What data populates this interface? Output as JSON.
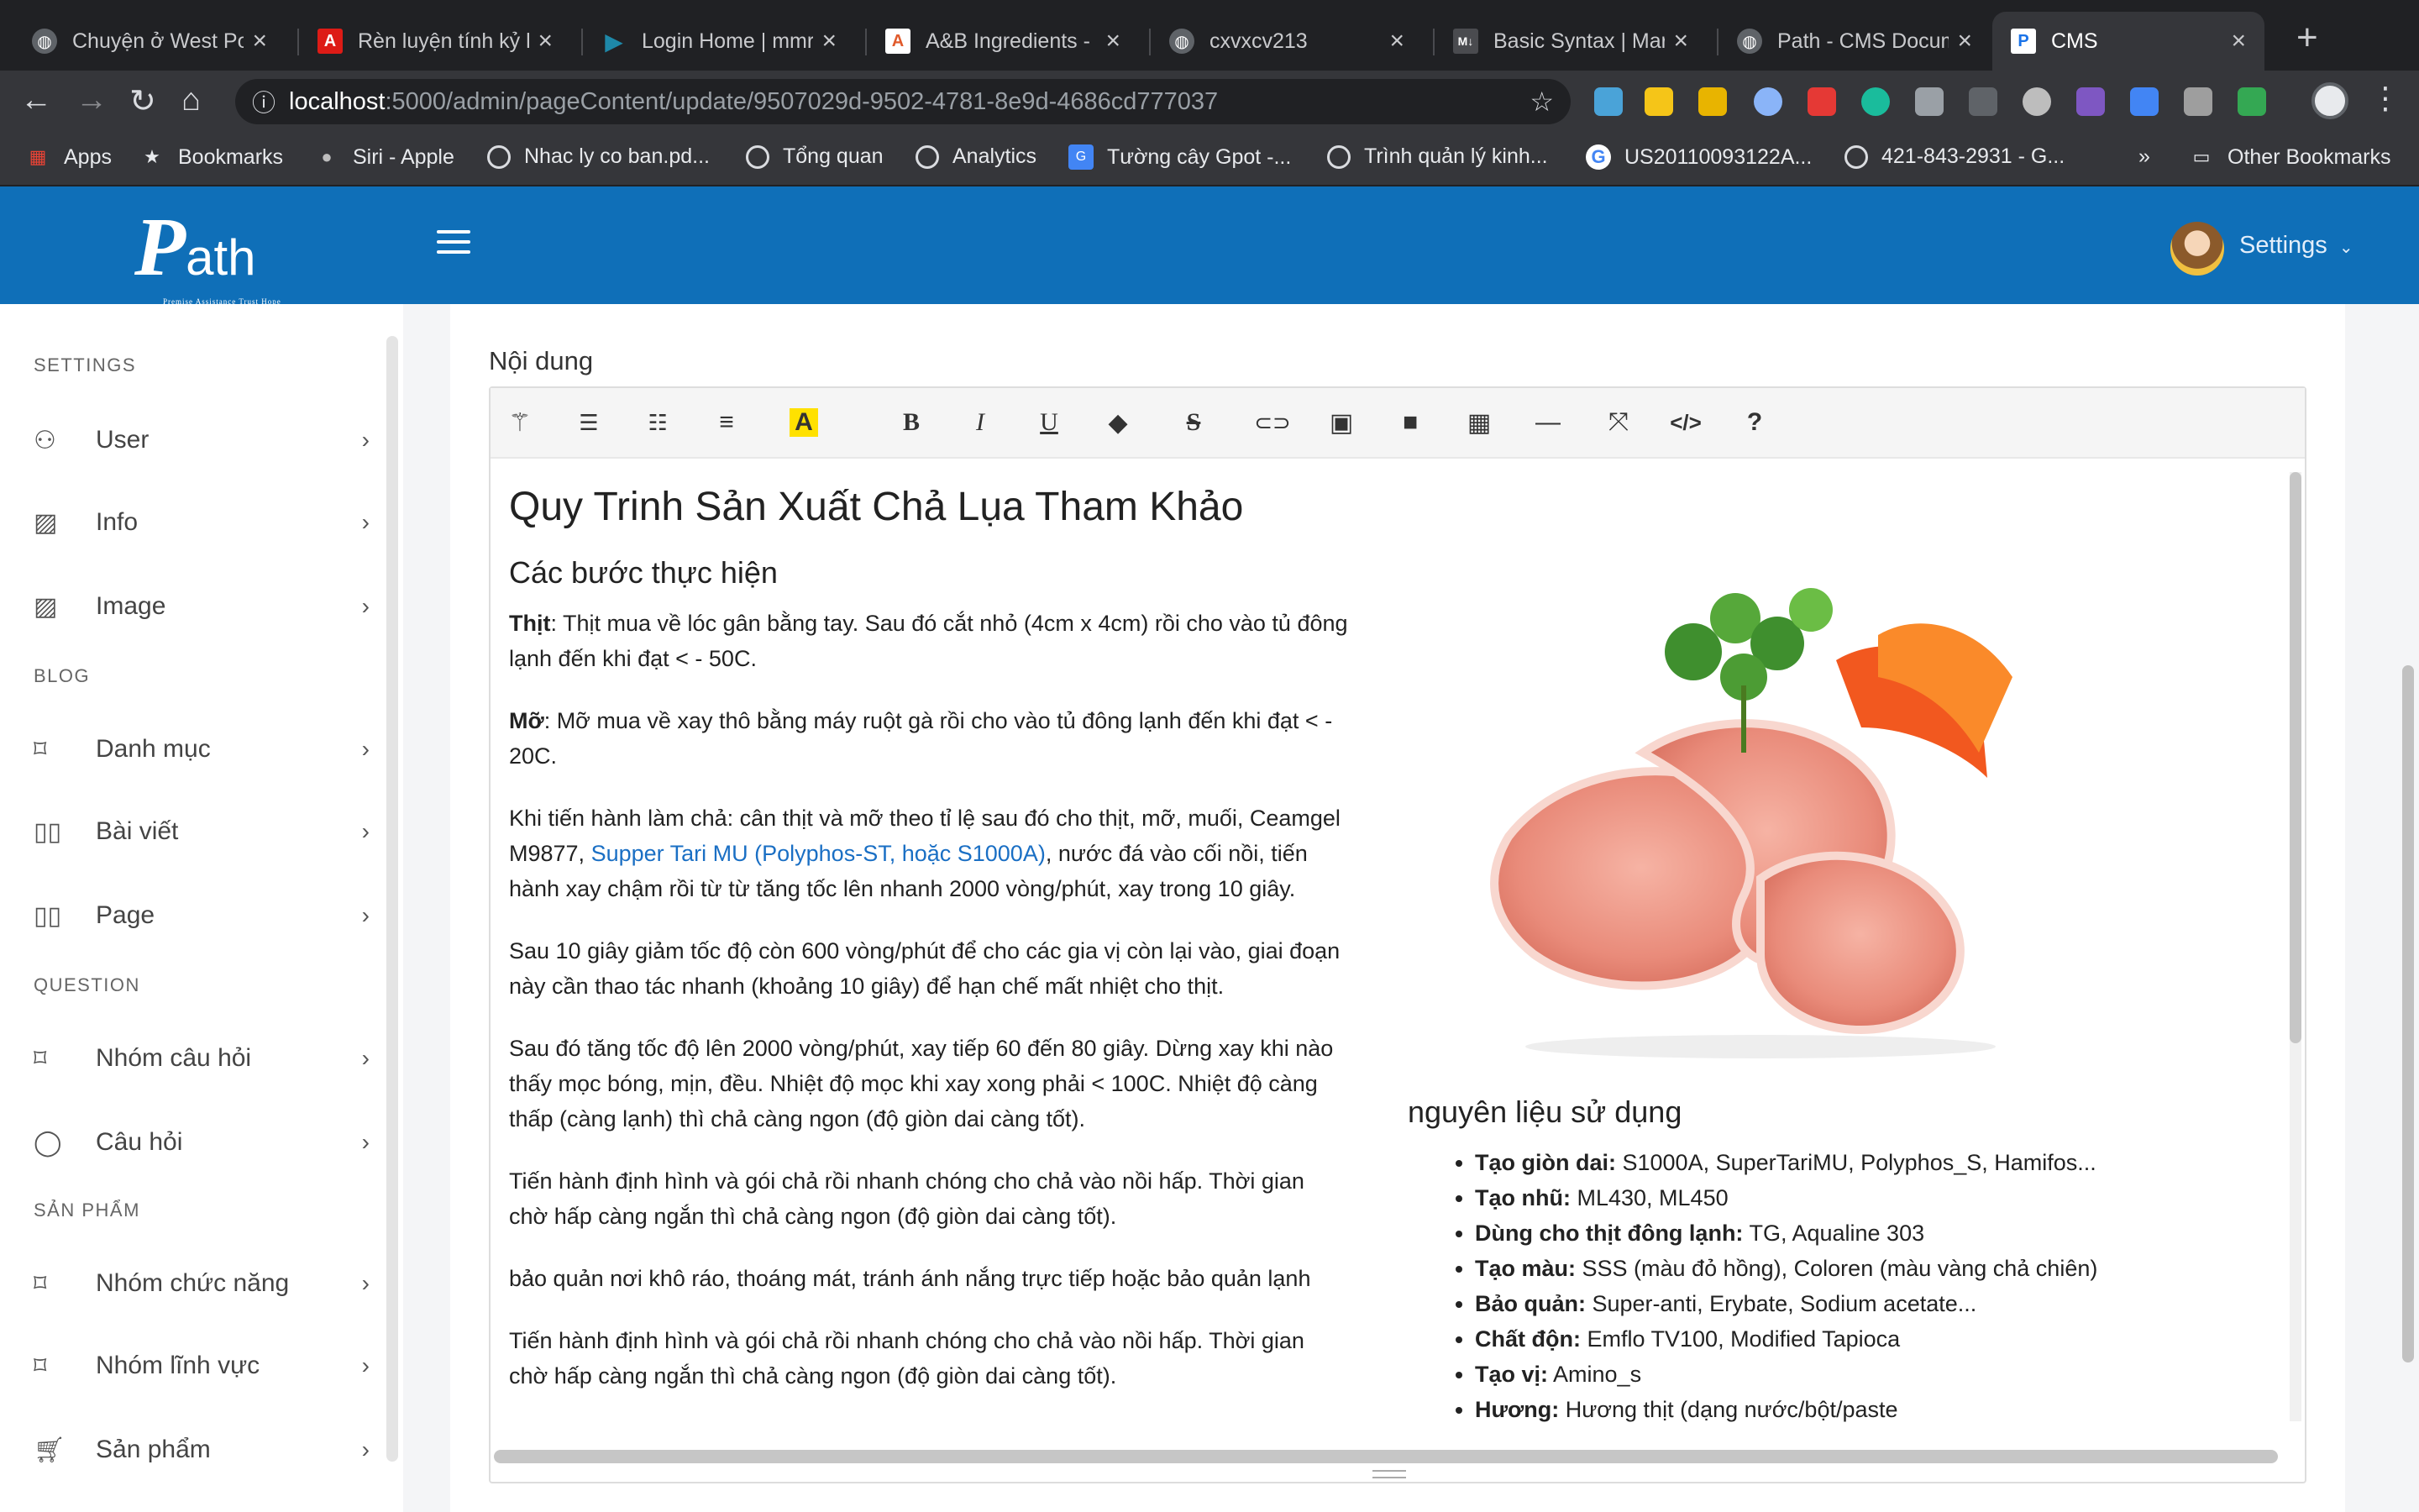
{
  "browser": {
    "tabs": [
      {
        "title": "Chuyện ở West Po",
        "icon": "globe-icon",
        "color": "#5f6368"
      },
      {
        "title": "Rèn luyện tính kỷ l",
        "icon": "angular-icon",
        "color": "#dd1b16"
      },
      {
        "title": "Login Home | mmr",
        "icon": "play-icon",
        "color": "#1e88a8"
      },
      {
        "title": "A&B Ingredients -",
        "icon": "ab-logo-icon",
        "color": "#e05a2b"
      },
      {
        "title": "cxvxcv213",
        "icon": "globe-icon",
        "color": "#5f6368"
      },
      {
        "title": "Basic Syntax | Mar",
        "icon": "markdown-icon",
        "color": "#4a4b4f"
      },
      {
        "title": "Path - CMS Docum",
        "icon": "globe-icon",
        "color": "#5f6368"
      },
      {
        "title": "CMS",
        "icon": "cms-icon",
        "color": "#1a73e8"
      }
    ],
    "url_host": "localhost",
    "url_path": ":5000/admin/pageContent/update/9507029d-9502-4781-8e9d-4686cd777037",
    "bookmarks": [
      {
        "label": "Apps",
        "icon": "apps-grid-icon"
      },
      {
        "label": "Bookmarks",
        "icon": "star-icon"
      },
      {
        "label": "Siri - Apple",
        "icon": "apple-icon"
      },
      {
        "label": "Nhac ly co ban.pd...",
        "icon": "globe-icon"
      },
      {
        "label": "Tổng quan",
        "icon": "globe-icon"
      },
      {
        "label": "Analytics",
        "icon": "globe-icon"
      },
      {
        "label": "Tường cây Gpot -...",
        "icon": "gpot-icon"
      },
      {
        "label": "Trình quản lý kinh...",
        "icon": "globe-icon"
      },
      {
        "label": "US20110093122A...",
        "icon": "google-icon"
      },
      {
        "label": "421-843-2931 - G...",
        "icon": "globe-icon"
      }
    ],
    "more_bookmarks": "»",
    "other_bookmarks": "Other Bookmarks"
  },
  "app": {
    "logo_text": "Path",
    "logo_tagline": "Premise Assistance Trust Hope",
    "settings_label": "Settings"
  },
  "sidebar": {
    "sections": [
      {
        "title": "SETTINGS",
        "items": [
          {
            "label": "User",
            "icon": "users-icon"
          },
          {
            "label": "Info",
            "icon": "image-icon"
          },
          {
            "label": "Image",
            "icon": "image-icon"
          }
        ]
      },
      {
        "title": "BLOG",
        "items": [
          {
            "label": "Danh mục",
            "icon": "tag-icon"
          },
          {
            "label": "Bài viết",
            "icon": "book-icon"
          },
          {
            "label": "Page",
            "icon": "book-icon"
          }
        ]
      },
      {
        "title": "QUESTION",
        "items": [
          {
            "label": "Nhóm câu hỏi",
            "icon": "tag-icon"
          },
          {
            "label": "Câu hỏi",
            "icon": "chat-bubble-icon"
          }
        ]
      },
      {
        "title": "SẢN PHẨM",
        "items": [
          {
            "label": "Nhóm chức năng",
            "icon": "tag-icon"
          },
          {
            "label": "Nhóm lĩnh vực",
            "icon": "tag-icon"
          },
          {
            "label": "Sản phẩm",
            "icon": "cart-icon"
          }
        ]
      }
    ]
  },
  "editor": {
    "field_label": "Nội dung",
    "toolbar": [
      {
        "name": "magic-wand-icon",
        "glyph": "✦"
      },
      {
        "name": "unordered-list-icon",
        "glyph": "☰"
      },
      {
        "name": "ordered-list-icon",
        "glyph": "≔"
      },
      {
        "name": "align-icon",
        "glyph": "≡"
      },
      {
        "name": "highlight-color-icon",
        "glyph": "A"
      },
      {
        "name": "bold-icon",
        "glyph": "B"
      },
      {
        "name": "italic-icon",
        "glyph": "I"
      },
      {
        "name": "underline-icon",
        "glyph": "U"
      },
      {
        "name": "eraser-icon",
        "glyph": "⌫"
      },
      {
        "name": "strikethrough-icon",
        "glyph": "S"
      },
      {
        "name": "link-icon",
        "glyph": "⊂⊃"
      },
      {
        "name": "picture-icon",
        "glyph": "▣"
      },
      {
        "name": "video-icon",
        "glyph": "▶"
      },
      {
        "name": "table-icon",
        "glyph": "▦"
      },
      {
        "name": "horizontal-rule-icon",
        "glyph": "—"
      },
      {
        "name": "fullscreen-icon",
        "glyph": "⤢"
      },
      {
        "name": "code-view-icon",
        "glyph": "</>"
      },
      {
        "name": "help-icon",
        "glyph": "?"
      }
    ],
    "heading": "Quy Trinh Sản Xuất Chả Lụa Tham Khảo",
    "subheading": "Các bước thực hiện",
    "paragraphs": {
      "p1_bold": "Thịt",
      "p1_text": ": Thịt mua về lóc gân bằng tay. Sau đó cắt nhỏ (4cm x 4cm) rồi cho vào tủ đông lạnh đến khi đạt < - 50C.",
      "p2_bold": "Mỡ",
      "p2_text": ": Mỡ mua về xay thô bằng máy ruột gà rồi cho vào tủ đông lạnh đến khi đạt < - 20C.",
      "p3_before": "Khi tiến hành làm chả: cân thịt và mỡ theo tỉ lệ sau đó cho thịt, mỡ, muối, Ceamgel M9877, ",
      "p3_link": "Supper Tari MU (Polyphos-ST, hoặc S1000A)",
      "p3_after": ", nước đá vào cối nồi, tiến hành xay chậm rồi từ từ tăng tốc lên nhanh 2000 vòng/phút, xay trong 10 giây.",
      "p4": "Sau 10 giây giảm tốc độ còn 600 vòng/phút để cho các gia vị còn lại vào, giai đoạn này cần thao tác nhanh (khoảng 10 giây) để hạn chế mất nhiệt cho thịt.",
      "p5": "Sau đó tăng tốc độ lên 2000 vòng/phút, xay tiếp 60 đến 80 giây. Dừng xay khi nào thấy mọc bóng, mịn, đều. Nhiệt độ mọc khi xay xong phải < 100C. Nhiệt độ càng thấp (càng lạnh) thì chả càng ngon (độ giòn dai càng tốt).",
      "p6": "Tiến hành định hình và gói chả rồi nhanh chóng cho chả vào nồi hấp. Thời gian chờ hấp càng ngắn thì chả càng ngon (độ giòn dai càng tốt).",
      "p7": "bảo quản nơi khô ráo, thoáng mát, tránh ánh nắng trực tiếp hoặc bảo quản lạnh",
      "p8": "Tiến hành định hình và gói chả rồi nhanh chóng cho chả vào nồi hấp. Thời gian chờ hấp càng ngắn thì chả càng ngon (độ giòn dai càng tốt)."
    },
    "ingredients_title": "nguyên liệu sử dụng",
    "ingredients": [
      {
        "label": "Tạo giòn dai:",
        "value": " S1000A, SuperTariMU, Polyphos_S, Hamifos..."
      },
      {
        "label": "Tạo nhũ:",
        "value": " ML430, ML450"
      },
      {
        "label": "Dùng cho thịt đông lạnh:",
        "value": " TG, Aqualine 303"
      },
      {
        "label": "Tạo màu:",
        "value": " SSS (màu đỏ hồng), Coloren (màu vàng chả chiên)"
      },
      {
        "label": "Bảo quản:",
        "value": " Super-anti, Erybate, Sodium acetate..."
      },
      {
        "label": "Chất độn:",
        "value": " Emflo TV100, Modified Tapioca"
      },
      {
        "label": "Tạo vị:",
        "value": " Amino_s"
      },
      {
        "label": "Hương:",
        "value": " Hương thịt (dạng nước/bột/paste"
      }
    ]
  },
  "colors": {
    "header_blue": "#0f6fb8",
    "link_blue": "#1a6fc4",
    "highlight_yellow": "#ffe100"
  }
}
